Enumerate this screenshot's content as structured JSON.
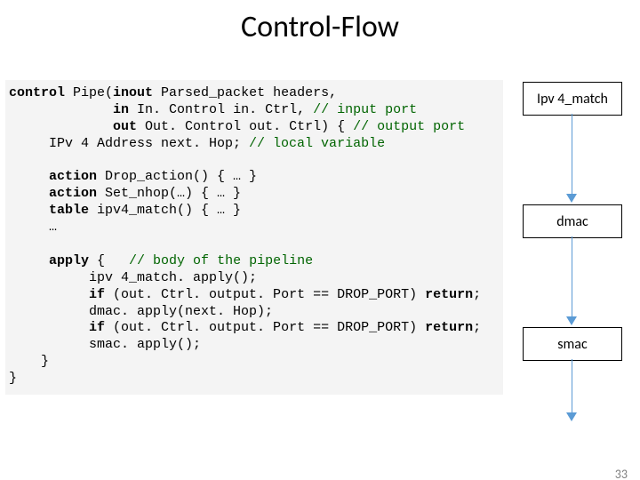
{
  "title": "Control-Flow",
  "pagenum": "33",
  "flow": {
    "box1": "Ipv 4_match",
    "box2": "dmac",
    "box3": "smac"
  },
  "code": {
    "l1a": "control",
    "l1b": " Pipe(",
    "l1c": "inout",
    "l1d": " Parsed_packet headers,",
    "l2a": "             ",
    "l2b": "in",
    "l2c": " In. Control in. Ctrl, ",
    "l2d": "// input port",
    "l3a": "             ",
    "l3b": "out",
    "l3c": " Out. Control out. Ctrl) { ",
    "l3d": "// output port",
    "l4a": "     IPv 4 Address next. Hop; ",
    "l4b": "// local variable",
    "blank1": "",
    "l5a": "     ",
    "l5b": "action",
    "l5c": " Drop_action() { … }",
    "l6a": "     ",
    "l6b": "action",
    "l6c": " Set_nhop(…) { … }",
    "l7a": "     ",
    "l7b": "table",
    "l7c": " ipv4_match() { … }",
    "l8": "     …",
    "blank2": "",
    "l9a": "     ",
    "l9b": "apply",
    "l9c": " {   ",
    "l9d": "// body of the pipeline",
    "l10": "          ipv 4_match. apply();",
    "l11a": "          ",
    "l11b": "if",
    "l11c": " (out. Ctrl. output. Port == DROP_PORT) ",
    "l11d": "return",
    "l11e": ";",
    "l12": "          dmac. apply(next. Hop);",
    "l13a": "          ",
    "l13b": "if",
    "l13c": " (out. Ctrl. output. Port == DROP_PORT) ",
    "l13d": "return",
    "l13e": ";",
    "l14": "          smac. apply();",
    "l15": "    }",
    "l16": "}"
  }
}
